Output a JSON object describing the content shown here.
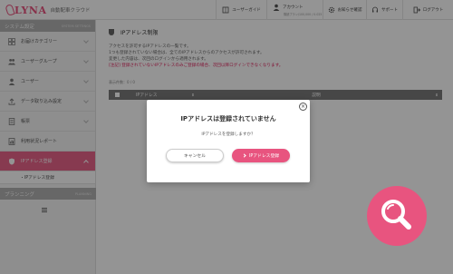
{
  "header": {
    "logo_text": "LYNA",
    "logo_sub": "自動配車クラウド",
    "buttons": {
      "guide": "ユーザーガイド",
      "account": "アカウント",
      "account_sub": "購読プラン/100,000 / 0.025",
      "notice": "お知らせ確認",
      "support": "サポート",
      "logout": "ログアウト"
    }
  },
  "sidebar": {
    "section_title": "システム設定",
    "section_ghost": "SYSTEM SETTINGS",
    "items": [
      {
        "label": "お届けカテゴリー",
        "icon": "grid-icon"
      },
      {
        "label": "ユーザーグループ",
        "icon": "users-icon"
      },
      {
        "label": "ユーザー",
        "icon": "user-icon"
      },
      {
        "label": "データ取り込み設定",
        "icon": "upload-icon"
      },
      {
        "label": "帳票",
        "icon": "document-icon"
      },
      {
        "label": "利用状況レポート",
        "icon": "report-icon"
      },
      {
        "label": "IPアドレス登録",
        "icon": "shield-icon"
      }
    ],
    "sub_item": "・IPアドレス登録",
    "section2_title": "プランニング",
    "section2_ghost": "PLANNING"
  },
  "main": {
    "title": "IPアドレス制限",
    "desc_lines": [
      "アクセスを許可するIPアドレスの一覧です。",
      "1つも登録されていない場合は、全てのIPアドレスからのアクセスが許可されます。",
      "変更した内容は、次回のログインから適用されます。"
    ],
    "warning": "[注記] 登録されていないIPアドレスのみご登録の場合、次回以降ログインできなくなります。",
    "count": "表示件数：0 / 0",
    "table": {
      "columns": [
        "IPアドレス",
        "説明"
      ]
    }
  },
  "modal": {
    "title": "IPアドレスは登録されていません",
    "message": "IPアドレスを登録しますか？",
    "cancel_label": "キャンセル",
    "register_label": "IPアドレス登録",
    "close_symbol": "×"
  },
  "colors": {
    "accent": "#e8547f",
    "sidebar_active": "#e8648a",
    "sidebar_header": "#b1b1b1",
    "table_header": "#7a7a7a"
  }
}
